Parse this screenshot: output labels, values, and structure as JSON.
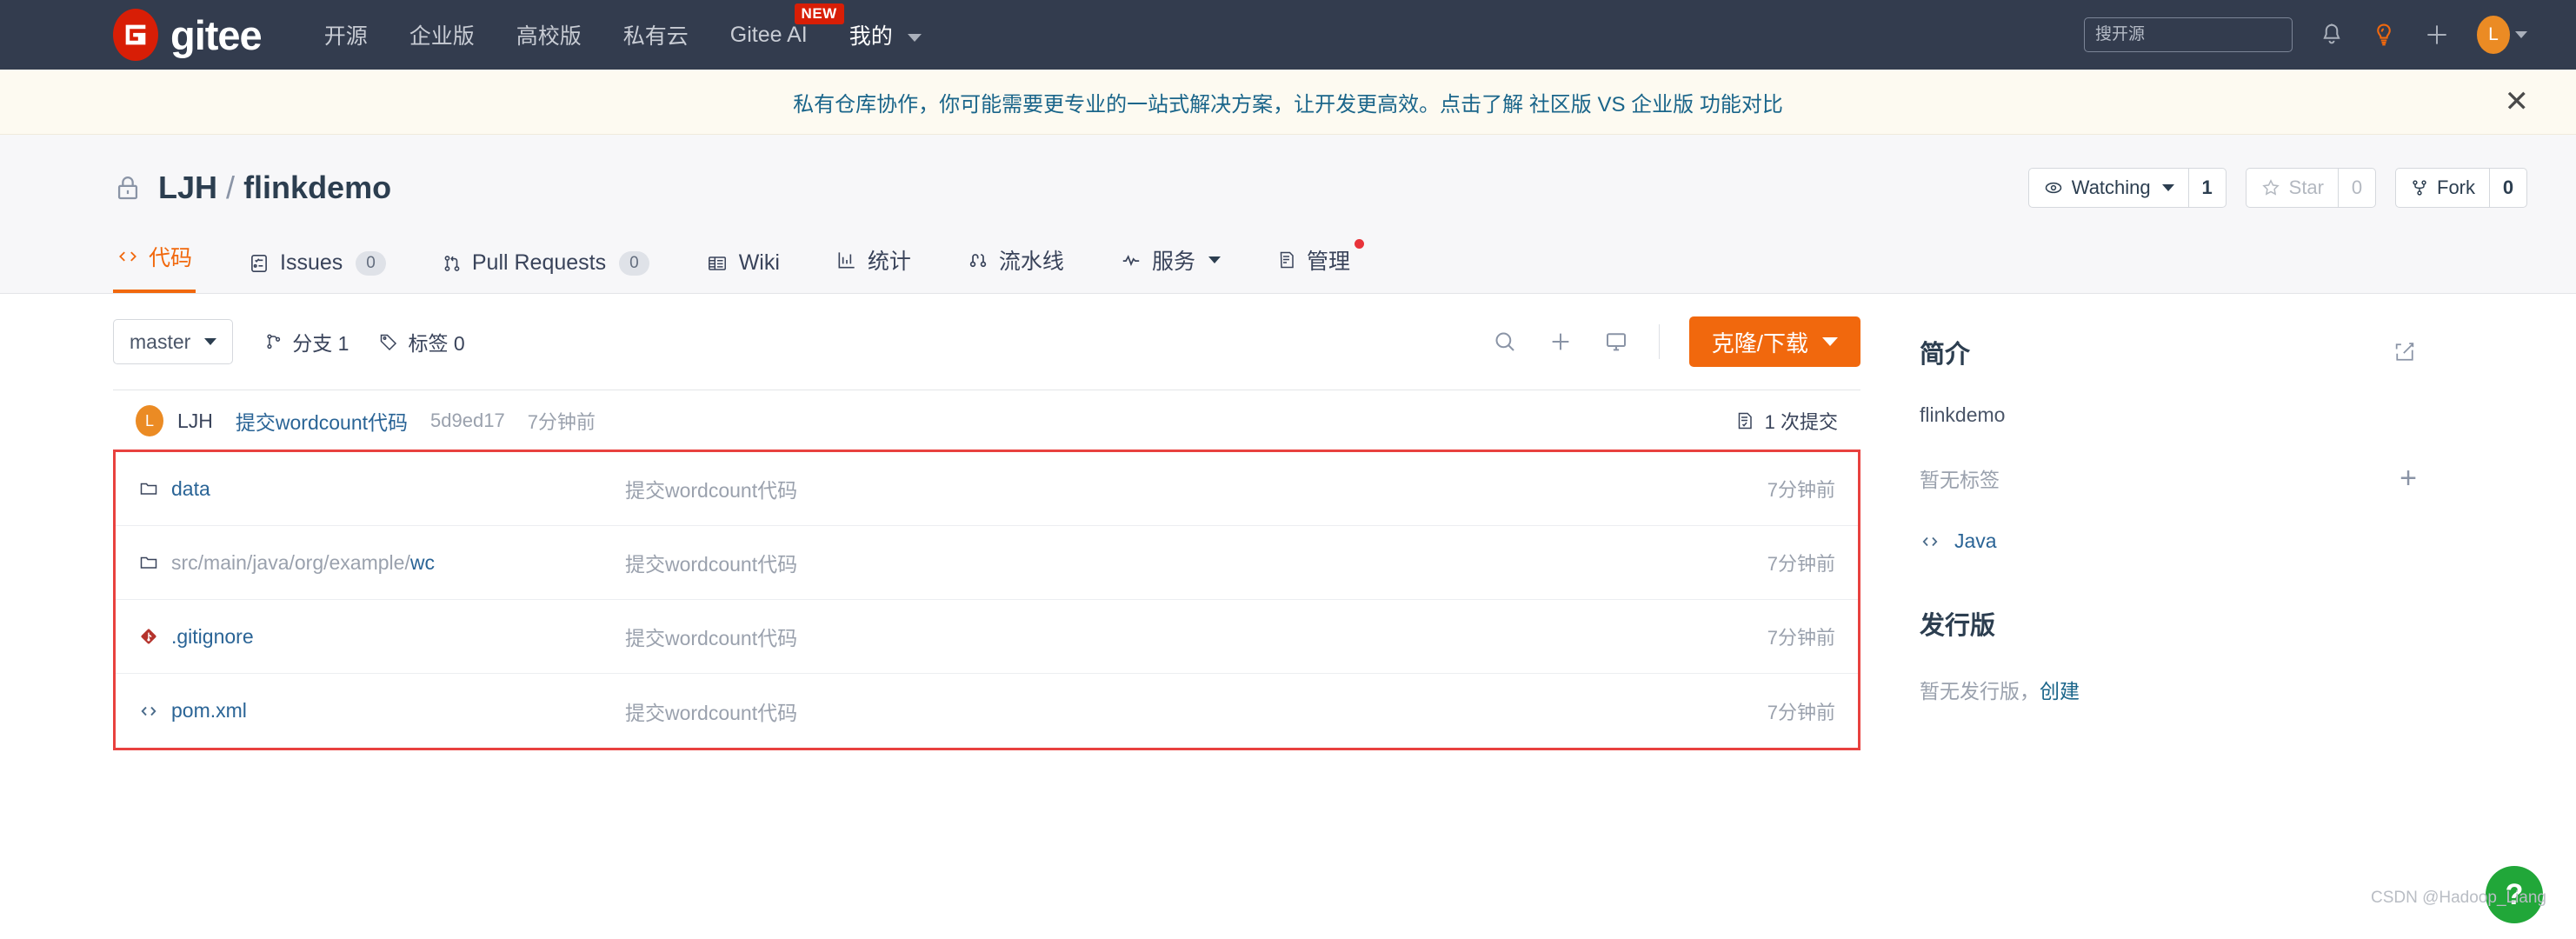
{
  "header": {
    "brand": "gitee",
    "nav_items": [
      {
        "label": "开源",
        "badge": null,
        "caret": false
      },
      {
        "label": "企业版",
        "badge": null,
        "caret": false
      },
      {
        "label": "高校版",
        "badge": null,
        "caret": false
      },
      {
        "label": "私有云",
        "badge": null,
        "caret": false
      },
      {
        "label": "Gitee AI",
        "badge": "NEW",
        "caret": false
      },
      {
        "label": "我的",
        "badge": null,
        "caret": true
      }
    ],
    "search_placeholder": "搜开源",
    "search_value": "",
    "icons": [
      "bell-icon",
      "lightbulb-icon",
      "plus-icon"
    ],
    "avatar_letter": "L",
    "colors": {
      "nav_bg": "#333c4e",
      "badge_red": "#d81e06",
      "avatar_orange": "#eb8b24",
      "bulb_orange": "#f1680d"
    }
  },
  "banner": {
    "text_before": "私有仓库协作，你可能需要更专业的一站式解决方案，让开发更高效。点击了解 ",
    "link_text": "社区版 VS 企业版 功能对比",
    "close_label": "✕"
  },
  "repo": {
    "owner": "LJH",
    "separator": "/",
    "name": "flinkdemo",
    "visibility_icon": "lock-icon",
    "watch": {
      "label": "Watching",
      "count": "1"
    },
    "star": {
      "label": "Star",
      "count": "0"
    },
    "fork": {
      "label": "Fork",
      "count": "0"
    }
  },
  "tabs": [
    {
      "label": "代码",
      "icon": "code-icon",
      "count": null,
      "active": true,
      "caret": false,
      "dot": false
    },
    {
      "label": "Issues",
      "icon": "issues-icon",
      "count": "0",
      "active": false,
      "caret": false,
      "dot": false
    },
    {
      "label": "Pull Requests",
      "icon": "pull-request-icon",
      "count": "0",
      "active": false,
      "caret": false,
      "dot": false
    },
    {
      "label": "Wiki",
      "icon": "wiki-icon",
      "count": null,
      "active": false,
      "caret": false,
      "dot": false
    },
    {
      "label": "统计",
      "icon": "stats-icon",
      "count": null,
      "active": false,
      "caret": false,
      "dot": false
    },
    {
      "label": "流水线",
      "icon": "pipeline-icon",
      "count": null,
      "active": false,
      "caret": false,
      "dot": false
    },
    {
      "label": "服务",
      "icon": "service-icon",
      "count": null,
      "active": false,
      "caret": true,
      "dot": false
    },
    {
      "label": "管理",
      "icon": "manage-icon",
      "count": null,
      "active": false,
      "caret": false,
      "dot": true
    }
  ],
  "toolbar": {
    "branch": "master",
    "branches_label": "分支 1",
    "tags_label": "标签 0",
    "icons": [
      "search-icon",
      "plus-icon",
      "monitor-icon"
    ],
    "clone_label": "克隆/下载"
  },
  "commit": {
    "avatar_letter": "L",
    "author": "LJH",
    "message": "提交wordcount代码",
    "sha": "5d9ed17",
    "time": "7分钟前",
    "count_label": "1 次提交"
  },
  "files": [
    {
      "icon": "folder-icon",
      "name": "data",
      "name_dim": "",
      "name_link": "data",
      "message": "提交wordcount代码",
      "time": "7分钟前"
    },
    {
      "icon": "folder-icon",
      "name": "src/main/java/org/example/wc",
      "name_dim": "src/main/java/org/example/",
      "name_link": "wc",
      "message": "提交wordcount代码",
      "time": "7分钟前"
    },
    {
      "icon": "git-file-icon",
      "name": ".gitignore",
      "name_dim": "",
      "name_link": ".gitignore",
      "message": "提交wordcount代码",
      "time": "7分钟前"
    },
    {
      "icon": "code-file-icon",
      "name": "pom.xml",
      "name_dim": "",
      "name_link": "pom.xml",
      "message": "提交wordcount代码",
      "time": "7分钟前"
    }
  ],
  "sidebar": {
    "about_title": "简介",
    "about_edit_icon": "edit-icon",
    "description": "flinkdemo",
    "no_tags": "暂无标签",
    "add_tag_icon": "+",
    "language": "Java",
    "releases_title": "发行版",
    "no_releases": "暂无发行版，",
    "create_release": "创建"
  },
  "floating": {
    "help_glyph": "?",
    "watermark": "CSDN @Hadoop_Liang"
  }
}
